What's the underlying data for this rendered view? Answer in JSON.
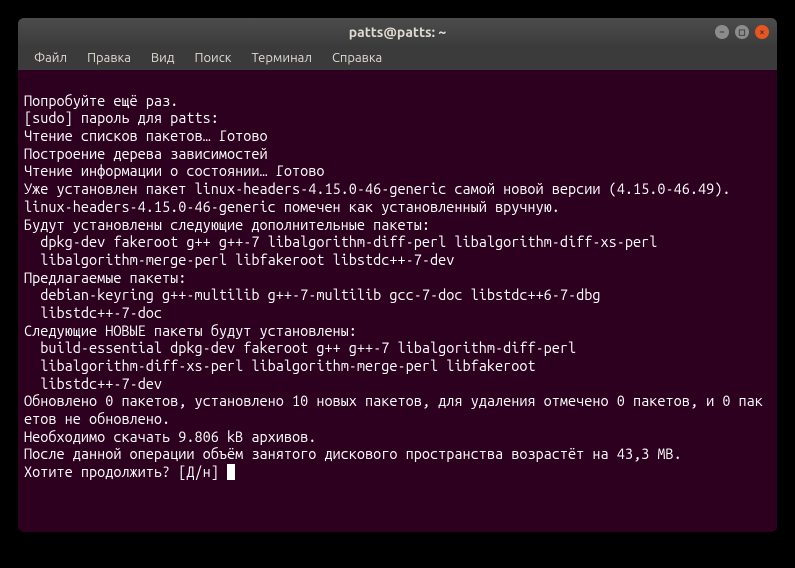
{
  "titlebar": {
    "title": "patts@patts: ~"
  },
  "menubar": {
    "items": [
      "Файл",
      "Правка",
      "Вид",
      "Поиск",
      "Терминал",
      "Справка"
    ]
  },
  "terminal": {
    "lines": [
      "Попробуйте ещё раз.",
      "[sudo] пароль для patts:",
      "Чтение списков пакетов… Готово",
      "Построение дерева зависимостей",
      "Чтение информации о состоянии… Готово",
      "Уже установлен пакет linux-headers-4.15.0-46-generic самой новой версии (4.15.0-46.49).",
      "linux-headers-4.15.0-46-generic помечен как установленный вручную.",
      "Будут установлены следующие дополнительные пакеты:",
      "  dpkg-dev fakeroot g++ g++-7 libalgorithm-diff-perl libalgorithm-diff-xs-perl",
      "  libalgorithm-merge-perl libfakeroot libstdc++-7-dev",
      "Предлагаемые пакеты:",
      "  debian-keyring g++-multilib g++-7-multilib gcc-7-doc libstdc++6-7-dbg",
      "  libstdc++-7-doc",
      "Следующие НОВЫЕ пакеты будут установлены:",
      "  build-essential dpkg-dev fakeroot g++ g++-7 libalgorithm-diff-perl",
      "  libalgorithm-diff-xs-perl libalgorithm-merge-perl libfakeroot",
      "  libstdc++-7-dev",
      "Обновлено 0 пакетов, установлено 10 новых пакетов, для удаления отмечено 0 пакетов, и 0 пакетов не обновлено.",
      "Необходимо скачать 9.806 kB архивов.",
      "После данной операции объём занятого дискового пространства возрастёт на 43,3 MB."
    ],
    "prompt": "Хотите продолжить? [Д/н] "
  }
}
